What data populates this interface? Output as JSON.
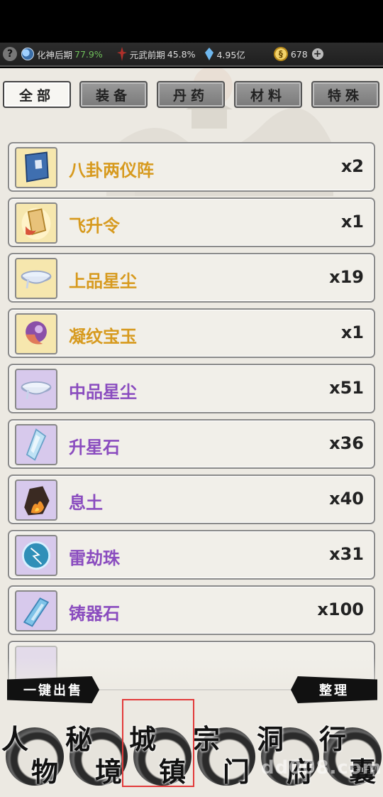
{
  "status": {
    "help": "?",
    "cultivation": "化神后期",
    "cultivation_pct": "77.9%",
    "martial": "元武前期",
    "martial_pct": "45.8%",
    "spirit_stones": "4.95亿",
    "coins": "678",
    "plus": "+"
  },
  "tabs": [
    "全部",
    "装备",
    "丹药",
    "材料",
    "特殊"
  ],
  "active_tab": "全部",
  "items": [
    {
      "name": "八卦两仪阵",
      "qty": "x2",
      "quality": "gold",
      "icon": "scroll-book-icon"
    },
    {
      "name": "飞升令",
      "qty": "x1",
      "quality": "gold",
      "icon": "ascension-token-icon"
    },
    {
      "name": "上品星尘",
      "qty": "x19",
      "quality": "gold",
      "icon": "stardust-dish-icon"
    },
    {
      "name": "凝纹宝玉",
      "qty": "x1",
      "quality": "gold",
      "icon": "jade-gem-icon"
    },
    {
      "name": "中品星尘",
      "qty": "x51",
      "quality": "purple",
      "icon": "stardust-dish-icon"
    },
    {
      "name": "升星石",
      "qty": "x36",
      "quality": "purple",
      "icon": "star-stone-icon"
    },
    {
      "name": "息土",
      "qty": "x40",
      "quality": "purple",
      "icon": "fire-rock-icon"
    },
    {
      "name": "雷劫珠",
      "qty": "x31",
      "quality": "purple",
      "icon": "thunder-orb-icon"
    },
    {
      "name": "铸器石",
      "qty": "x100",
      "quality": "purple",
      "icon": "crystal-shard-icon"
    }
  ],
  "actions": {
    "sell_all": "一键出售",
    "sort": "整理"
  },
  "nav": [
    {
      "c1": "人",
      "c2": "物"
    },
    {
      "c1": "秘",
      "c2": "境"
    },
    {
      "c1": "城",
      "c2": "镇"
    },
    {
      "c1": "宗",
      "c2": "门"
    },
    {
      "c1": "洞",
      "c2": "府"
    },
    {
      "c1": "行",
      "c2": "囊"
    }
  ],
  "watermark": "dd008.com",
  "colors": {
    "gold_text": "#d79a1e",
    "purple_text": "#8a4cbf",
    "highlight": "#e23a3a"
  }
}
